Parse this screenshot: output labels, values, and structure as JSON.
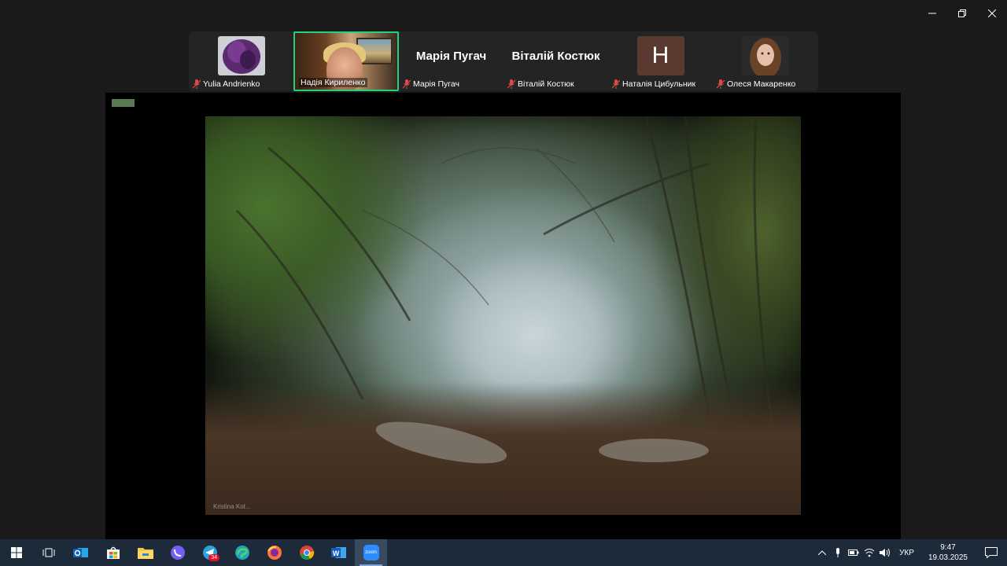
{
  "participants": [
    {
      "name": "Yulia Andrienko",
      "type": "photo",
      "muted": true
    },
    {
      "name": "Надія Кириленко",
      "type": "video",
      "muted": false,
      "active": true
    },
    {
      "name": "Марія Пугач",
      "type": "name",
      "muted": true
    },
    {
      "name": "Віталій Костюк",
      "type": "name",
      "muted": true
    },
    {
      "name": "Наталія Цибульник",
      "type": "letter",
      "letter": "H",
      "muted": true
    },
    {
      "name": "Олеся Макаренко",
      "type": "photo",
      "muted": true
    }
  ],
  "share": {
    "watermark": "Kristina Kot..."
  },
  "taskbar": {
    "apps": [
      "windows-start-icon",
      "task-view-icon",
      "outlook-icon",
      "store-icon",
      "file-explorer-icon",
      "viber-icon",
      "telegram-icon",
      "edge-icon",
      "firefox-icon",
      "chrome-icon",
      "word-icon",
      "zoom-icon"
    ],
    "telegram_badge": "34",
    "zoom_label": "zoom",
    "language": "УКР",
    "time": "9:47",
    "date": "19.03.2025"
  },
  "colors": {
    "active_border": "#22d37b",
    "taskbar_bg": "#1d2a3a",
    "mute_red": "#e04848"
  }
}
